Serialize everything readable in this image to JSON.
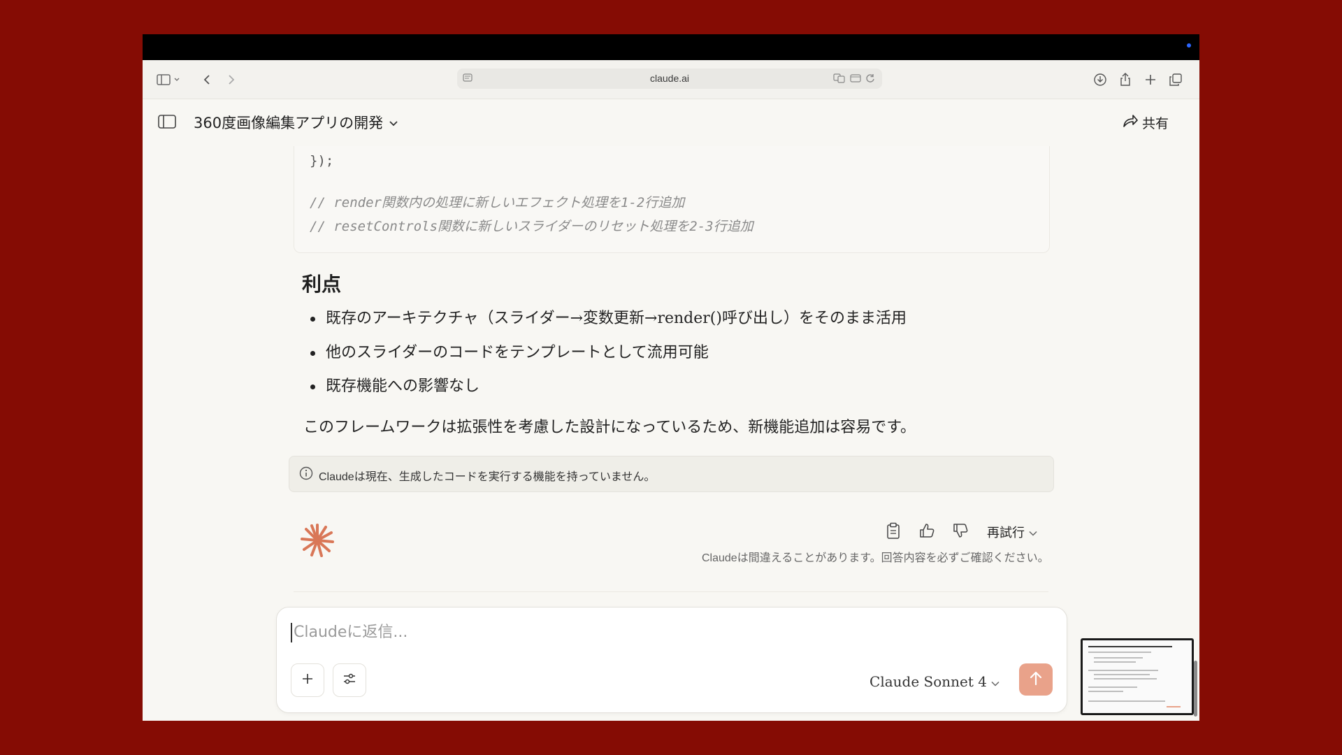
{
  "browser": {
    "url": "claude.ai"
  },
  "header": {
    "title": "360度画像編集アプリの開発",
    "share_label": "共有"
  },
  "code": {
    "lines": [
      "});",
      "",
      "// render関数内の処理に新しいエフェクト処理を1-2行追加",
      "// resetControls関数に新しいスライダーのリセット処理を2-3行追加"
    ]
  },
  "content": {
    "heading": "利点",
    "bullets": [
      "既存のアーキテクチャ（スライダー→変数更新→render()呼び出し）をそのまま活用",
      "他のスライダーのコードをテンプレートとして流用可能",
      "既存機能への影響なし"
    ],
    "paragraph": "このフレームワークは拡張性を考慮した設計になっているため、新機能追加は容易です。"
  },
  "notice": {
    "text": "Claudeは現在、生成したコードを実行する機能を持っていません。"
  },
  "message_actions": {
    "retry_label": "再試行",
    "disclaimer": "Claudeは間違えることがあります。回答内容を必ずご確認ください。"
  },
  "composer": {
    "placeholder": "Claudeに返信...",
    "model_label": "Claude Sonnet 4"
  },
  "colors": {
    "background": "#850c04",
    "accent": "#d97757",
    "send_button": "#e9a28a"
  }
}
